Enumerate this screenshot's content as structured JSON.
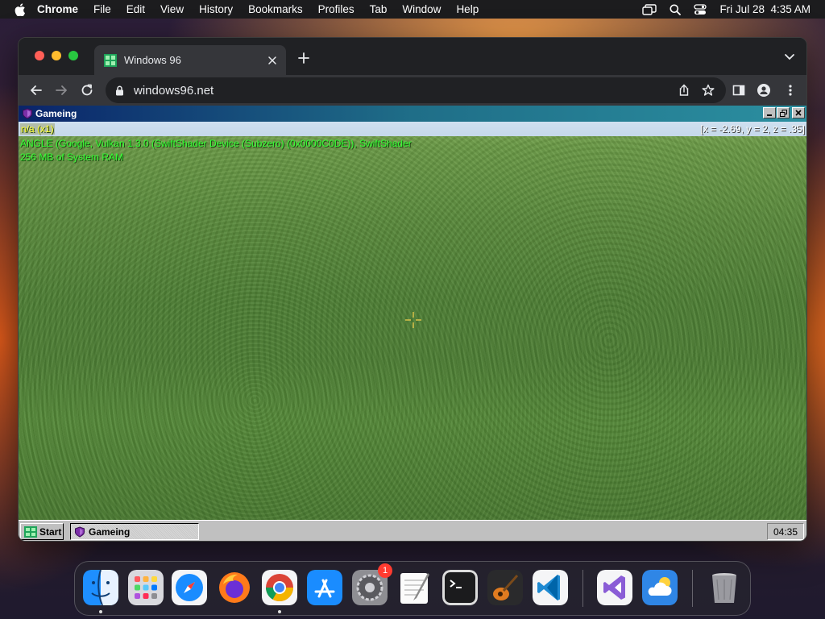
{
  "menubar": {
    "app_name": "Chrome",
    "items": [
      "File",
      "Edit",
      "View",
      "History",
      "Bookmarks",
      "Profiles",
      "Tab",
      "Window",
      "Help"
    ],
    "clock": "Fri Jul 28  4:35 AM"
  },
  "browser": {
    "tab_title": "Windows 96",
    "url": "windows96.net"
  },
  "win96": {
    "window_title": "Gameing",
    "hud": {
      "fps": "n/a (x1)",
      "gpu": "ANGLE (Google, Vulkan 1.3.0 (SwiftShader Device (Subzero) (0x0000C0DE)), SwiftShader",
      "ram": "256 MB of System RAM",
      "coords": "[x = -2.69, y = 2, z = .35]"
    },
    "taskbar": {
      "start_label": "Start",
      "task_label": "Gameing",
      "time": "04:35"
    }
  },
  "dock": {
    "apps": [
      "finder-icon",
      "launchpad-icon",
      "safari-icon",
      "firefox-icon",
      "chrome-icon",
      "app-store-icon",
      "system-settings-icon",
      "textedit-icon",
      "terminal-icon",
      "garageband-icon",
      "vscode-icon",
      "visual-studio-icon",
      "weather-icon",
      "trash-icon"
    ],
    "settings_badge": "1"
  }
}
